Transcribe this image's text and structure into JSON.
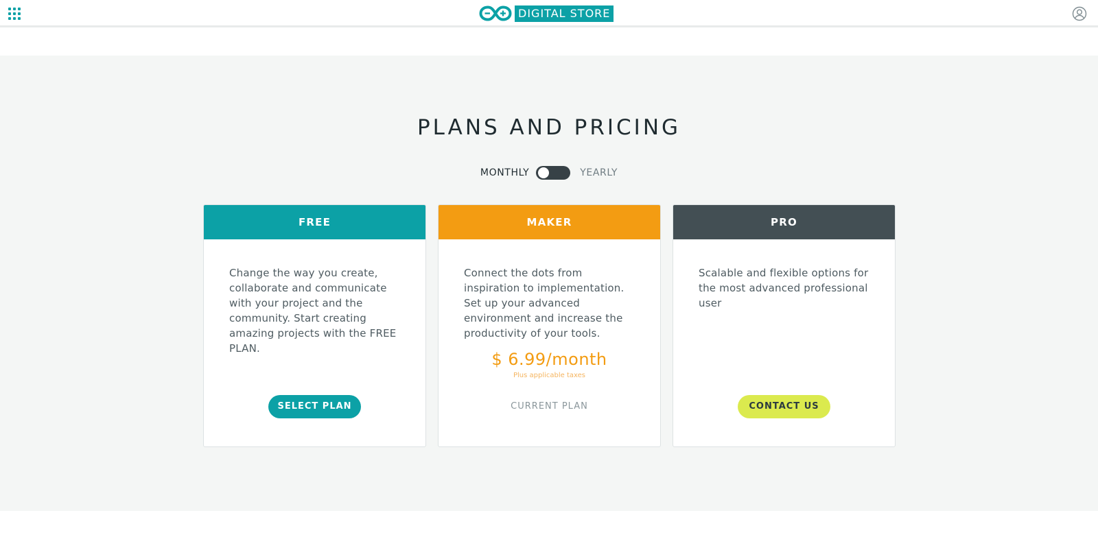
{
  "header": {
    "apps_icon": "grid-icon",
    "brand": "DIGITAL STORE",
    "profile_icon": "user-circle-icon"
  },
  "page": {
    "title": "PLANS AND PRICING"
  },
  "billing": {
    "monthly_label": "MONTHLY",
    "yearly_label": "YEARLY",
    "selected": "MONTHLY"
  },
  "plans": [
    {
      "name": "FREE",
      "description": "Change the way you create, collaborate and communicate with your project and the community. Start creating amazing projects with the FREE PLAN.",
      "action_label": "SELECT PLAN"
    },
    {
      "name": "MAKER",
      "description": "Connect the dots from inspiration to implementation. Set up your advanced environment and increase the productivity of your tools.",
      "price": "$ 6.99/month",
      "price_note": "Plus applicable taxes",
      "status_label": "CURRENT PLAN"
    },
    {
      "name": "PRO",
      "description": "Scalable and flexible options for the most advanced professional user",
      "action_label": "CONTACT US"
    }
  ],
  "colors": {
    "teal": "#0ca1a6",
    "orange": "#f39c12",
    "dark": "#434f54",
    "lime": "#dbea4e",
    "background": "#f4f6f5"
  }
}
